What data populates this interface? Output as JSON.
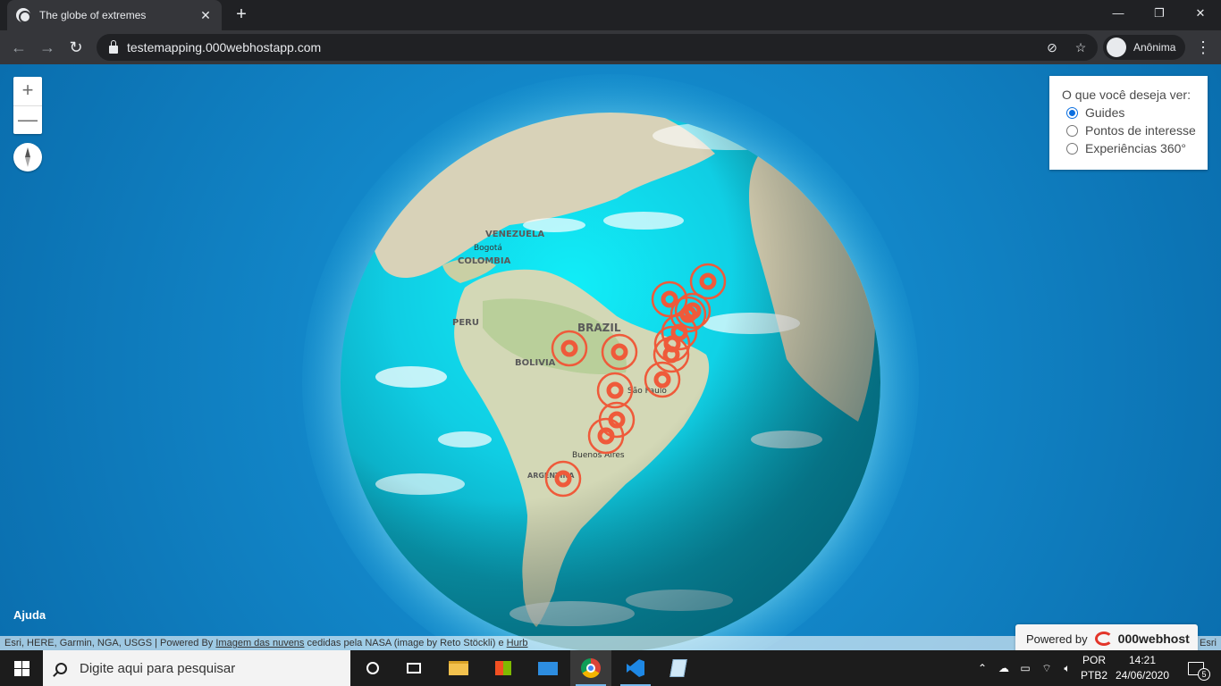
{
  "browser": {
    "tab_title": "The globe of extremes",
    "url": "testemapping.000webhostapp.com",
    "profile_name": "Anônima",
    "window_buttons": [
      "minimize",
      "maximize",
      "close"
    ]
  },
  "map": {
    "zoom_in_label": "+",
    "zoom_out_label": "—",
    "help_label": "Ajuda",
    "country_labels": [
      "VENEZUELA",
      "COLOMBIA",
      "BRAZIL",
      "BOLIVIA",
      "PERU",
      "ARGENTINA"
    ],
    "city_labels": [
      "Bogotá",
      "São Paulo",
      "Buenos Aires"
    ],
    "marker_color": "#ef5a3a",
    "ocean_color": "#15c8e0",
    "marker_count": 14
  },
  "panel": {
    "question": "O que você deseja ver:",
    "options": [
      {
        "label": "Guides",
        "selected": true
      },
      {
        "label": "Pontos de interesse",
        "selected": false
      },
      {
        "label": "Experiências 360°",
        "selected": false
      }
    ]
  },
  "attribution": {
    "prefix": "Esri, HERE, Garmin, NGA, USGS | Powered By ",
    "link1": "Imagem das nuvens",
    "middle": " cedidas pela NASA (image by Reto Stöckli) e ",
    "link2": "Hurb",
    "esri_powered": "Powered by Esri"
  },
  "hosting_badge": {
    "prefix": "Powered by",
    "brand": "000webhost"
  },
  "taskbar": {
    "search_placeholder": "Digite aqui para pesquisar",
    "lang_line1": "POR",
    "lang_line2": "PTB2",
    "time": "14:21",
    "date": "24/06/2020",
    "notification_count": "5"
  }
}
